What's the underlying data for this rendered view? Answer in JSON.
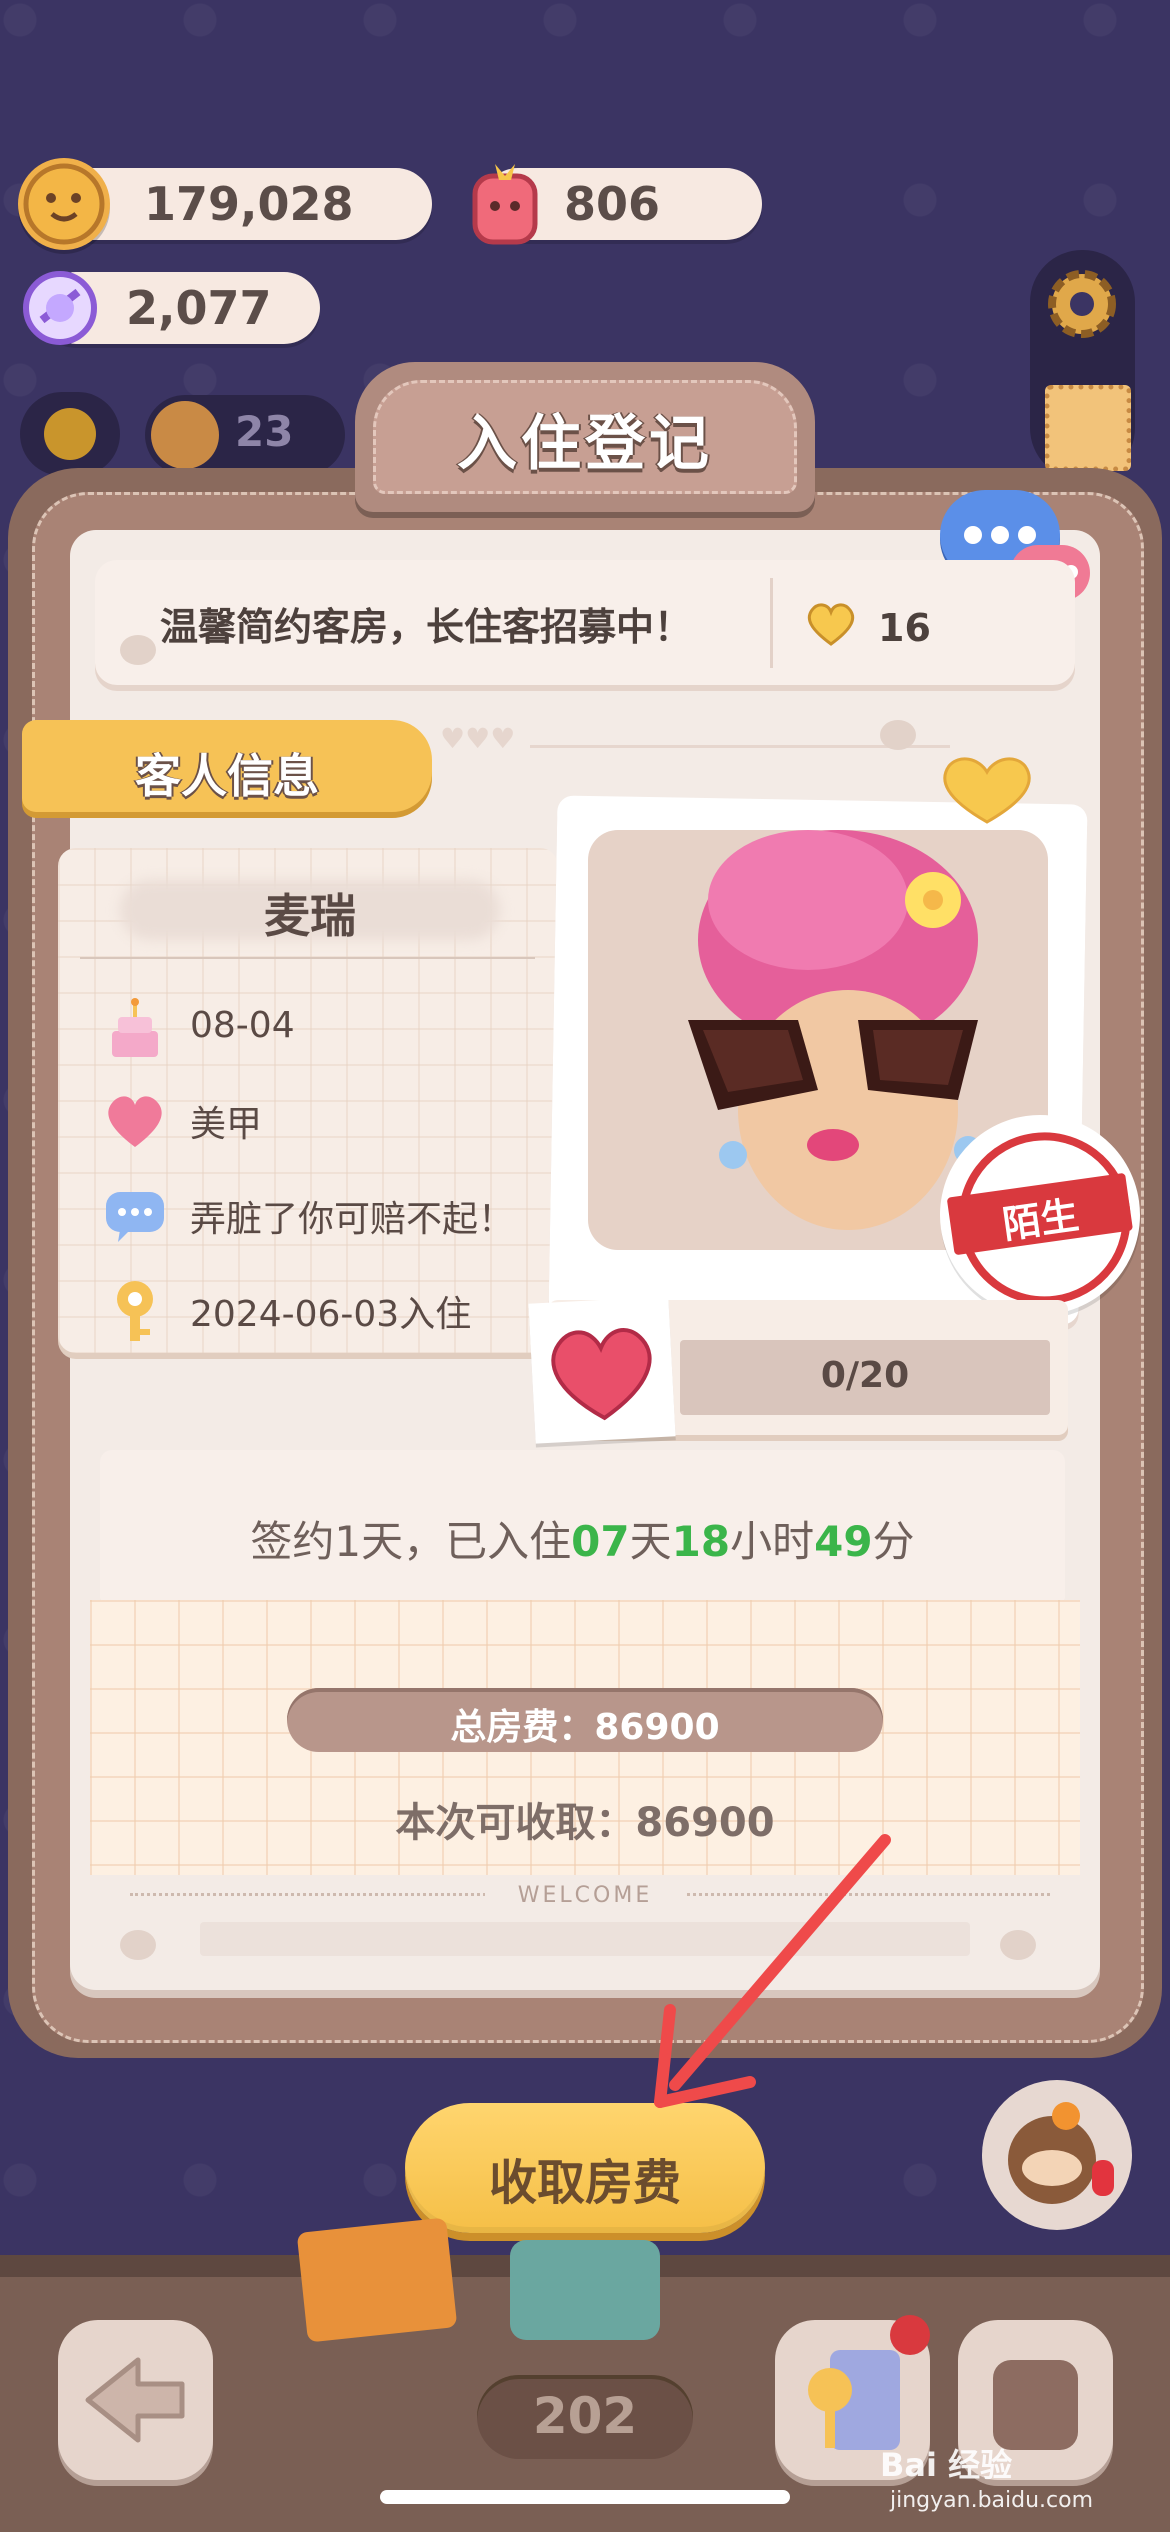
{
  "currencies": {
    "cookies": "179,028",
    "gems": "806",
    "candy": "2,077"
  },
  "top_left": {
    "level": "23"
  },
  "header": {
    "title": "入住登记"
  },
  "ad_banner": {
    "text": "温馨简约客房，长住客招募中！",
    "likes": "16"
  },
  "guest_section": {
    "label": "客人信息",
    "name": "麦瑞",
    "birthday": "08-04",
    "hobby": "美甲",
    "quote": "弄脏了你可赔不起！",
    "checkin_date": "2024-06-03入住"
  },
  "relationship": {
    "stamp": "陌生",
    "progress_text": "0/20",
    "progress_value": 0
  },
  "contract": {
    "prefix": "签约1天，已入住",
    "days": "07",
    "days_unit": "天",
    "hours": "18",
    "hours_unit": "小时",
    "minutes": "49",
    "minutes_unit": "分"
  },
  "fees": {
    "total": "总房费：86900",
    "collectable": "本次可收取：86900"
  },
  "welcome": "WELCOME",
  "actions": {
    "collect_button": "收取房费"
  },
  "footer": {
    "room_number": "202"
  },
  "watermark": {
    "main": "Bai 经验",
    "sub": "jingyan.baidu.com"
  },
  "colors": {
    "background": "#3b3463",
    "accent_yellow": "#f6c256",
    "stamp_red": "#d9393e",
    "timer_green": "#3bb54a",
    "arrow_red": "#ef4a4a"
  }
}
